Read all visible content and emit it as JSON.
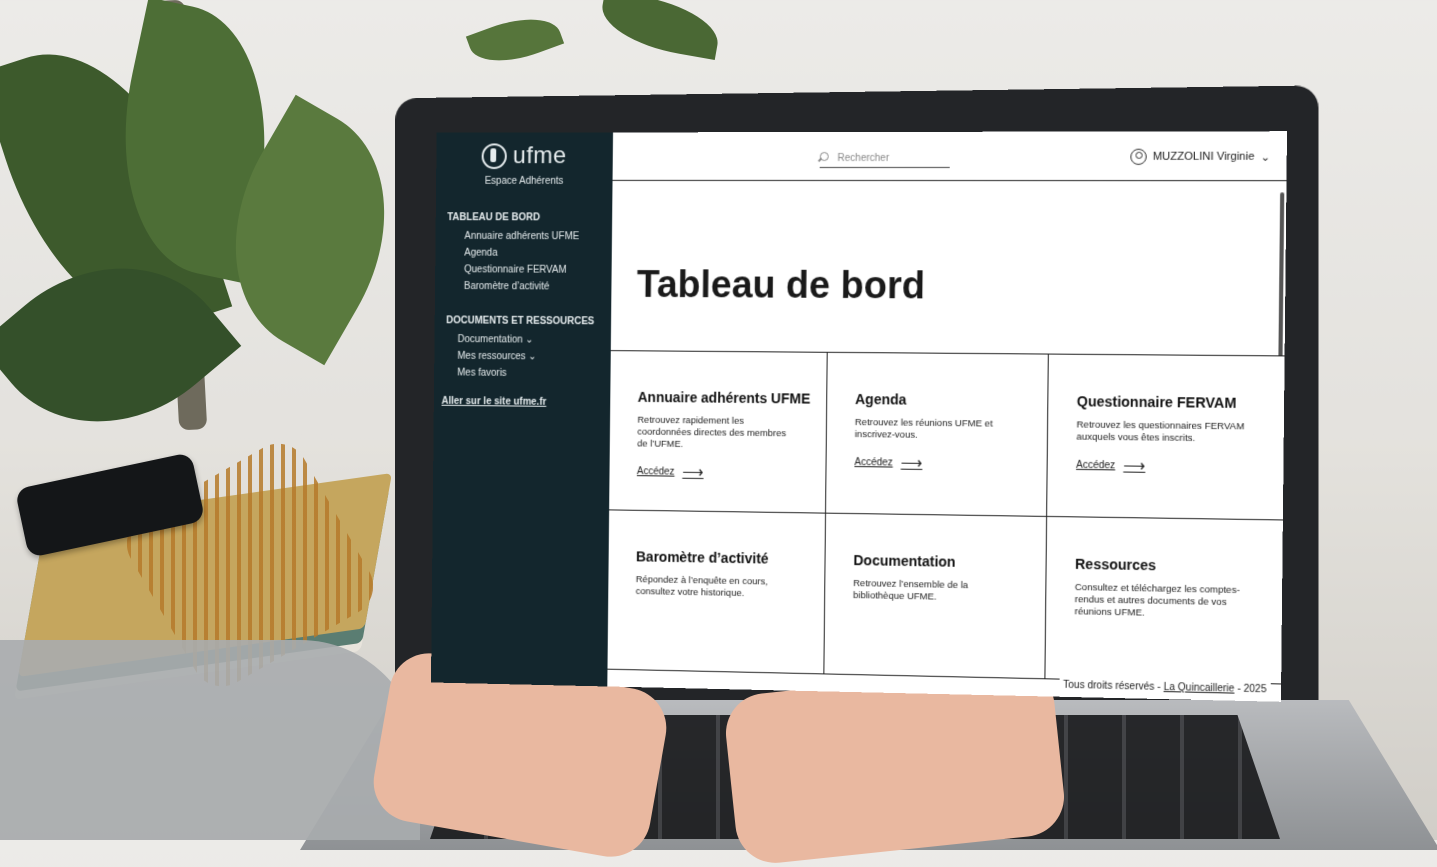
{
  "brand": {
    "logo_text": "ufme",
    "subtitle": "Espace Adhérents"
  },
  "sidebar": {
    "sections": [
      {
        "title": "TABLEAU DE BORD",
        "items": [
          "Annuaire adhérents UFME",
          "Agenda",
          "Questionnaire FERVAM",
          "Baromètre d’activité"
        ]
      },
      {
        "title": "DOCUMENTS ET RESSOURCES",
        "items": [
          "Documentation ⌄",
          "Mes ressources ⌄",
          "Mes favoris"
        ]
      }
    ],
    "external_link": "Aller sur le site ufme.fr"
  },
  "header": {
    "search_placeholder": "Rechercher",
    "user_name": "MUZZOLINI Virginie",
    "chevron": "⌄"
  },
  "main": {
    "title": "Tableau de bord",
    "cards": [
      {
        "title": "Annuaire adhérents UFME",
        "text": "Retrouvez rapidement les coordonnées directes des membres de l’UFME.",
        "cta": "Accédez"
      },
      {
        "title": "Agenda",
        "text": "Retrouvez les réunions UFME et inscrivez-vous.",
        "cta": "Accédez"
      },
      {
        "title": "Questionnaire FERVAM",
        "text": "Retrouvez les questionnaires FERVAM auxquels vous êtes inscrits.",
        "cta": "Accédez"
      },
      {
        "title": "Baromètre d’activité",
        "text": "Répondez à l’enquête en cours, consultez votre historique.",
        "cta": ""
      },
      {
        "title": "Documentation",
        "text": "Retrouvez l’ensemble de la bibliothèque UFME.",
        "cta": ""
      },
      {
        "title": "Ressources",
        "text": "Consultez et téléchargez les comptes-rendus et autres documents de vos réunions UFME.",
        "cta": ""
      }
    ],
    "arrow": "⟶"
  },
  "footer": {
    "prefix": "Tous droits réservés - ",
    "link": "La Quincaillerie",
    "suffix": " - 2025"
  },
  "colors": {
    "sidebar_bg": "#13262d",
    "text": "#111111"
  }
}
